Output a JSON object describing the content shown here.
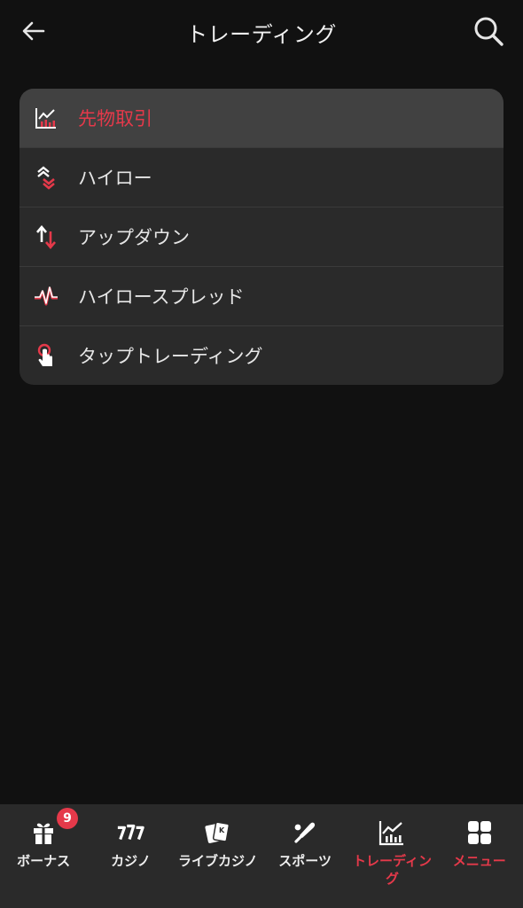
{
  "header": {
    "title": "トレーディング",
    "back_icon": "arrow-left-icon",
    "search_icon": "search-icon"
  },
  "menu": {
    "items": [
      {
        "label": "先物取引",
        "icon": "chart-icon",
        "active": true
      },
      {
        "label": "ハイロー",
        "icon": "chevrons-up-down-icon",
        "active": false
      },
      {
        "label": "アップダウン",
        "icon": "arrows-up-down-icon",
        "active": false
      },
      {
        "label": "ハイロースプレッド",
        "icon": "pulse-icon",
        "active": false
      },
      {
        "label": "タップトレーディング",
        "icon": "tap-icon",
        "active": false
      }
    ]
  },
  "tabbar": {
    "tabs": [
      {
        "label": "ボーナス",
        "icon": "gift-icon",
        "badge": "9",
        "active": false
      },
      {
        "label": "カジノ",
        "icon": "slots-777-icon",
        "active": false
      },
      {
        "label": "ライブカジノ",
        "icon": "cards-icon",
        "active": false
      },
      {
        "label": "スポーツ",
        "icon": "bat-ball-icon",
        "active": false
      },
      {
        "label": "トレーディング",
        "icon": "chart-icon",
        "active": true
      },
      {
        "label": "メニュー",
        "icon": "grid-icon",
        "active": false
      }
    ]
  },
  "colors": {
    "background": "#111111",
    "card": "#2a2a2a",
    "active_row": "#414141",
    "accent": "#e5394a",
    "text": "#e6e6e6"
  }
}
